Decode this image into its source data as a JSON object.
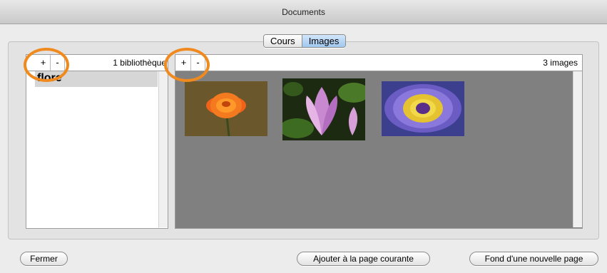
{
  "window": {
    "title": "Documents"
  },
  "segmented": {
    "tabs": [
      {
        "label": "Cours",
        "selected": false
      },
      {
        "label": "Images",
        "selected": true
      }
    ]
  },
  "library_panel": {
    "add_label": "+",
    "remove_label": "-",
    "count_label": "1 bibliothèque",
    "items": [
      {
        "label": "flore",
        "selected": true
      }
    ]
  },
  "images_panel": {
    "add_label": "+",
    "remove_label": "-",
    "count_label": "3 images",
    "images": [
      {
        "subject": "orange flower",
        "icon": "orange-flower-thumbnail"
      },
      {
        "subject": "pink magnolia flower",
        "icon": "magnolia-thumbnail"
      },
      {
        "subject": "purple and yellow water lily",
        "icon": "waterlily-thumbnail"
      }
    ]
  },
  "buttons": {
    "close": "Fermer",
    "add_to_page": "Ajouter à la page courante",
    "new_page_background": "Fond d'une nouvelle page"
  },
  "colors": {
    "highlight_ring": "#f08a1e",
    "selected_segment": "#9fc7ef",
    "image_area_bg": "#808080"
  }
}
